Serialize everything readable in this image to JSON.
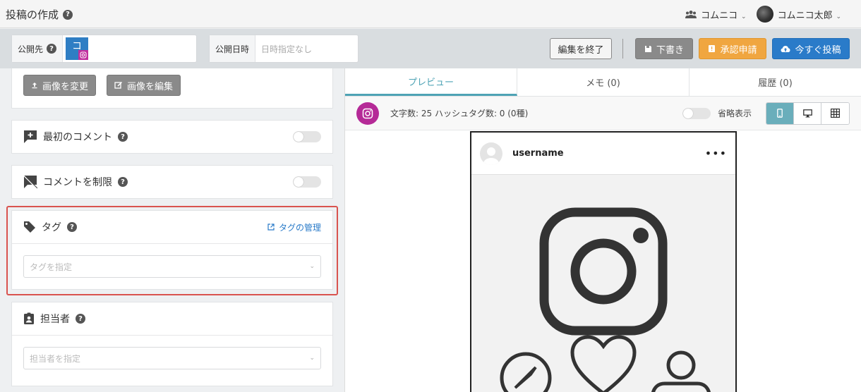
{
  "header": {
    "title": "投稿の作成",
    "group_name": "コムニコ",
    "user_name": "コムニコ太郎"
  },
  "toolbar": {
    "publish_to_label": "公開先",
    "account_chip_text": "コ",
    "publish_datetime_label": "公開日時",
    "publish_datetime_placeholder": "日時指定なし",
    "end_edit_label": "編集を終了",
    "draft_label": "下書き",
    "approval_label": "承認申請",
    "post_now_label": "今すぐ投稿"
  },
  "image_actions": {
    "change_label": "画像を変更",
    "edit_label": "画像を編集"
  },
  "first_comment": {
    "label": "最初のコメント",
    "enabled": false
  },
  "restrict_comments": {
    "label": "コメントを制限",
    "enabled": false
  },
  "tags": {
    "label": "タグ",
    "manage_link": "タグの管理",
    "placeholder": "タグを指定"
  },
  "assignee": {
    "label": "担当者",
    "placeholder": "担当者を指定"
  },
  "preview": {
    "tabs": [
      {
        "label": "プレビュー",
        "active": true
      },
      {
        "label": "メモ (0)",
        "active": false
      },
      {
        "label": "履歴 (0)",
        "active": false
      }
    ],
    "stats": "文字数: 25 ハッシュタグ数: 0 (0種)",
    "omit_label": "省略表示",
    "username": "username",
    "accent_color": "#4ea3b5",
    "instagram_color": "#b52a97"
  }
}
